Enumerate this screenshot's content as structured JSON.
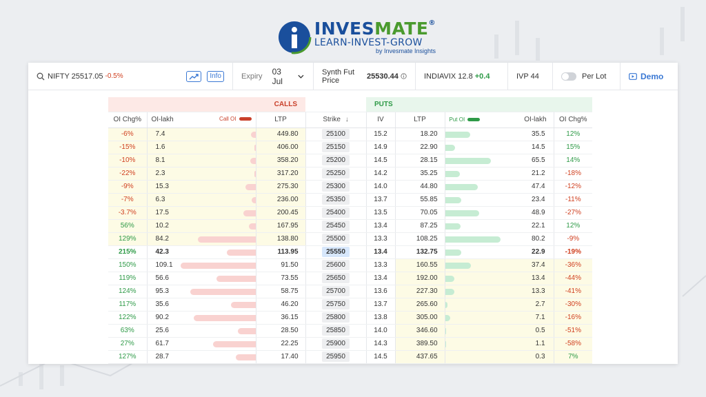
{
  "logo": {
    "brand_part1": "INVES",
    "brand_part2": "MATE",
    "registered": "®",
    "tagline": "LEARN-INVEST-GROW",
    "byline": "by Invesmate Insights"
  },
  "topbar": {
    "symbol": "NIFTY 25517.05",
    "change": "-0.5%",
    "info_label": "Info",
    "expiry_label": "Expiry",
    "expiry_value": "03 Jul",
    "synth_label": "Synth Fut Price",
    "synth_value": "25530.44",
    "vix_label": "INDIAVIX 12.8",
    "vix_change": "+0.4",
    "ivp": "IVP 44",
    "per_lot_label": "Per Lot",
    "demo_label": "Demo"
  },
  "table": {
    "calls_label": "CALLS",
    "puts_label": "PUTS",
    "headers": {
      "oi_chg": "OI Chg%",
      "oi_lakh": "OI-lakh",
      "call_oi": "Call OI",
      "ltp": "LTP",
      "strike": "Strike",
      "iv": "IV",
      "put_oi": "Put OI",
      "put_oi_lakh": "OI-lakh",
      "put_oi_chg": "OI Chg%"
    },
    "max_oi": 110,
    "rows": [
      {
        "c_chg": "-6%",
        "c_oi": "7.4",
        "c_oi_v": 7.4,
        "c_ltp": "449.80",
        "strike": "25100",
        "iv": "15.2",
        "p_ltp": "18.20",
        "p_oi": "35.5",
        "p_oi_v": 35.5,
        "p_chg": "12%"
      },
      {
        "c_chg": "-15%",
        "c_oi": "1.6",
        "c_oi_v": 1.6,
        "c_ltp": "406.00",
        "strike": "25150",
        "iv": "14.9",
        "p_ltp": "22.90",
        "p_oi": "14.5",
        "p_oi_v": 14.5,
        "p_chg": "15%"
      },
      {
        "c_chg": "-10%",
        "c_oi": "8.1",
        "c_oi_v": 8.1,
        "c_ltp": "358.20",
        "strike": "25200",
        "iv": "14.5",
        "p_ltp": "28.15",
        "p_oi": "65.5",
        "p_oi_v": 65.5,
        "p_chg": "14%"
      },
      {
        "c_chg": "-22%",
        "c_oi": "2.3",
        "c_oi_v": 2.3,
        "c_ltp": "317.20",
        "strike": "25250",
        "iv": "14.2",
        "p_ltp": "35.25",
        "p_oi": "21.2",
        "p_oi_v": 21.2,
        "p_chg": "-18%"
      },
      {
        "c_chg": "-9%",
        "c_oi": "15.3",
        "c_oi_v": 15.3,
        "c_ltp": "275.30",
        "strike": "25300",
        "iv": "14.0",
        "p_ltp": "44.80",
        "p_oi": "47.4",
        "p_oi_v": 47.4,
        "p_chg": "-12%"
      },
      {
        "c_chg": "-7%",
        "c_oi": "6.3",
        "c_oi_v": 6.3,
        "c_ltp": "236.00",
        "strike": "25350",
        "iv": "13.7",
        "p_ltp": "55.85",
        "p_oi": "23.4",
        "p_oi_v": 23.4,
        "p_chg": "-11%"
      },
      {
        "c_chg": "-3.7%",
        "c_oi": "17.5",
        "c_oi_v": 17.5,
        "c_ltp": "200.45",
        "strike": "25400",
        "iv": "13.5",
        "p_ltp": "70.05",
        "p_oi": "48.9",
        "p_oi_v": 48.9,
        "p_chg": "-27%"
      },
      {
        "c_chg": "56%",
        "c_oi": "10.2",
        "c_oi_v": 10.2,
        "c_ltp": "167.95",
        "strike": "25450",
        "iv": "13.4",
        "p_ltp": "87.25",
        "p_oi": "22.1",
        "p_oi_v": 22.1,
        "p_chg": "12%"
      },
      {
        "c_chg": "129%",
        "c_oi": "84.2",
        "c_oi_v": 84.2,
        "c_ltp": "138.80",
        "strike": "25500",
        "iv": "13.3",
        "p_ltp": "108.25",
        "p_oi": "80.2",
        "p_oi_v": 80.2,
        "p_chg": "-9%"
      },
      {
        "c_chg": "215%",
        "c_oi": "42.3",
        "c_oi_v": 42.3,
        "c_ltp": "113.95",
        "strike": "25550",
        "iv": "13.4",
        "p_ltp": "132.75",
        "p_oi": "22.9",
        "p_oi_v": 22.9,
        "p_chg": "-19%",
        "atm": true
      },
      {
        "c_chg": "150%",
        "c_oi": "109.1",
        "c_oi_v": 109.1,
        "c_ltp": "91.50",
        "strike": "25600",
        "iv": "13.3",
        "p_ltp": "160.55",
        "p_oi": "37.4",
        "p_oi_v": 37.4,
        "p_chg": "-36%"
      },
      {
        "c_chg": "119%",
        "c_oi": "56.6",
        "c_oi_v": 56.6,
        "c_ltp": "73.55",
        "strike": "25650",
        "iv": "13.4",
        "p_ltp": "192.00",
        "p_oi": "13.4",
        "p_oi_v": 13.4,
        "p_chg": "-44%"
      },
      {
        "c_chg": "124%",
        "c_oi": "95.3",
        "c_oi_v": 95.3,
        "c_ltp": "58.75",
        "strike": "25700",
        "iv": "13.6",
        "p_ltp": "227.30",
        "p_oi": "13.3",
        "p_oi_v": 13.3,
        "p_chg": "-41%"
      },
      {
        "c_chg": "117%",
        "c_oi": "35.6",
        "c_oi_v": 35.6,
        "c_ltp": "46.20",
        "strike": "25750",
        "iv": "13.7",
        "p_ltp": "265.60",
        "p_oi": "2.7",
        "p_oi_v": 2.7,
        "p_chg": "-30%"
      },
      {
        "c_chg": "122%",
        "c_oi": "90.2",
        "c_oi_v": 90.2,
        "c_ltp": "36.15",
        "strike": "25800",
        "iv": "13.8",
        "p_ltp": "305.00",
        "p_oi": "7.1",
        "p_oi_v": 7.1,
        "p_chg": "-16%"
      },
      {
        "c_chg": "63%",
        "c_oi": "25.6",
        "c_oi_v": 25.6,
        "c_ltp": "28.50",
        "strike": "25850",
        "iv": "14.0",
        "p_ltp": "346.60",
        "p_oi": "0.5",
        "p_oi_v": 0.5,
        "p_chg": "-51%"
      },
      {
        "c_chg": "27%",
        "c_oi": "61.7",
        "c_oi_v": 61.7,
        "c_ltp": "22.25",
        "strike": "25900",
        "iv": "14.3",
        "p_ltp": "389.50",
        "p_oi": "1.1",
        "p_oi_v": 1.1,
        "p_chg": "-58%"
      },
      {
        "c_chg": "127%",
        "c_oi": "28.7",
        "c_oi_v": 28.7,
        "c_ltp": "17.40",
        "strike": "25950",
        "iv": "14.5",
        "p_ltp": "437.65",
        "p_oi": "0.3",
        "p_oi_v": 0.3,
        "p_chg": "7%"
      }
    ]
  },
  "colors": {
    "negative": "#d04020",
    "positive": "#2e9a47",
    "accent": "#3a78d4",
    "calls": "#c9402a",
    "puts": "#2e9a47"
  }
}
